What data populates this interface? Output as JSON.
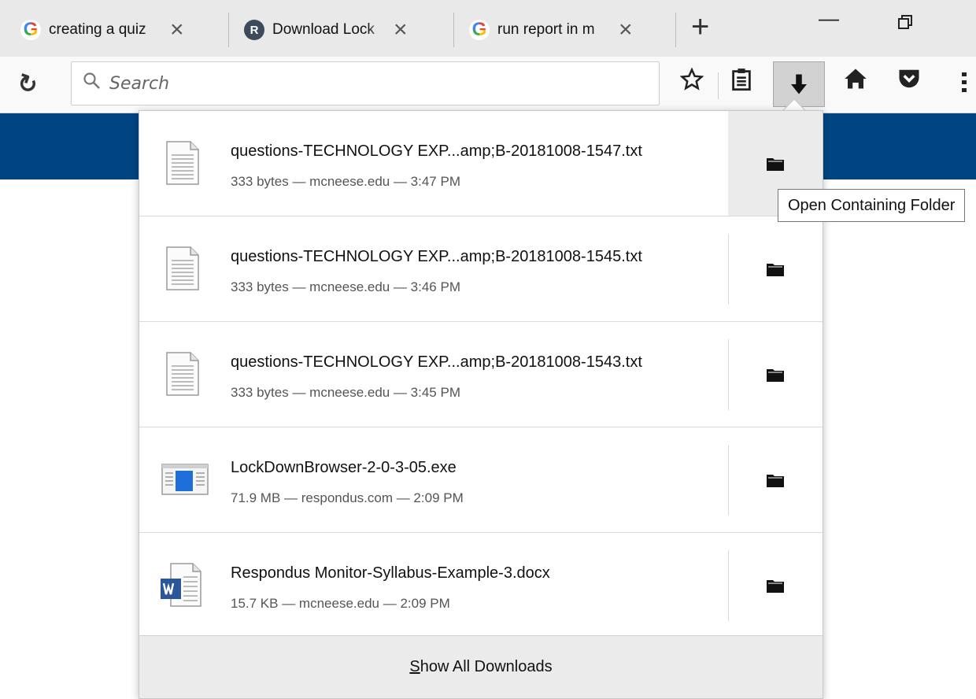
{
  "tabs": [
    {
      "favicon": "google-icon",
      "label": "creating a quiz"
    },
    {
      "favicon": "R",
      "label": "Download Lock"
    },
    {
      "favicon": "google-icon",
      "label": "run report in m"
    }
  ],
  "search": {
    "placeholder": "Search"
  },
  "downloads": [
    {
      "name": "questions-TECHNOLOGY EXP...amp;B-20181008-1547.txt",
      "meta": "333 bytes — mcneese.edu — 3:47 PM",
      "type": "text"
    },
    {
      "name": "questions-TECHNOLOGY EXP...amp;B-20181008-1545.txt",
      "meta": "333 bytes — mcneese.edu — 3:46 PM",
      "type": "text"
    },
    {
      "name": "questions-TECHNOLOGY EXP...amp;B-20181008-1543.txt",
      "meta": "333 bytes — mcneese.edu — 3:45 PM",
      "type": "text"
    },
    {
      "name": "LockDownBrowser-2-0-3-05.exe",
      "meta": "71.9 MB — respondus.com — 2:09 PM",
      "type": "exe"
    },
    {
      "name": "Respondus Monitor-Syllabus-Example-3.docx",
      "meta": "15.7 KB — mcneese.edu — 2:09 PM",
      "type": "word"
    }
  ],
  "show_all": {
    "accel": "S",
    "rest": "how All Downloads"
  },
  "tooltip": "Open Containing Folder",
  "colors": {
    "page_band": "#004582",
    "word_blue": "#2b579a",
    "exe_blue": "#1e6fd9"
  }
}
